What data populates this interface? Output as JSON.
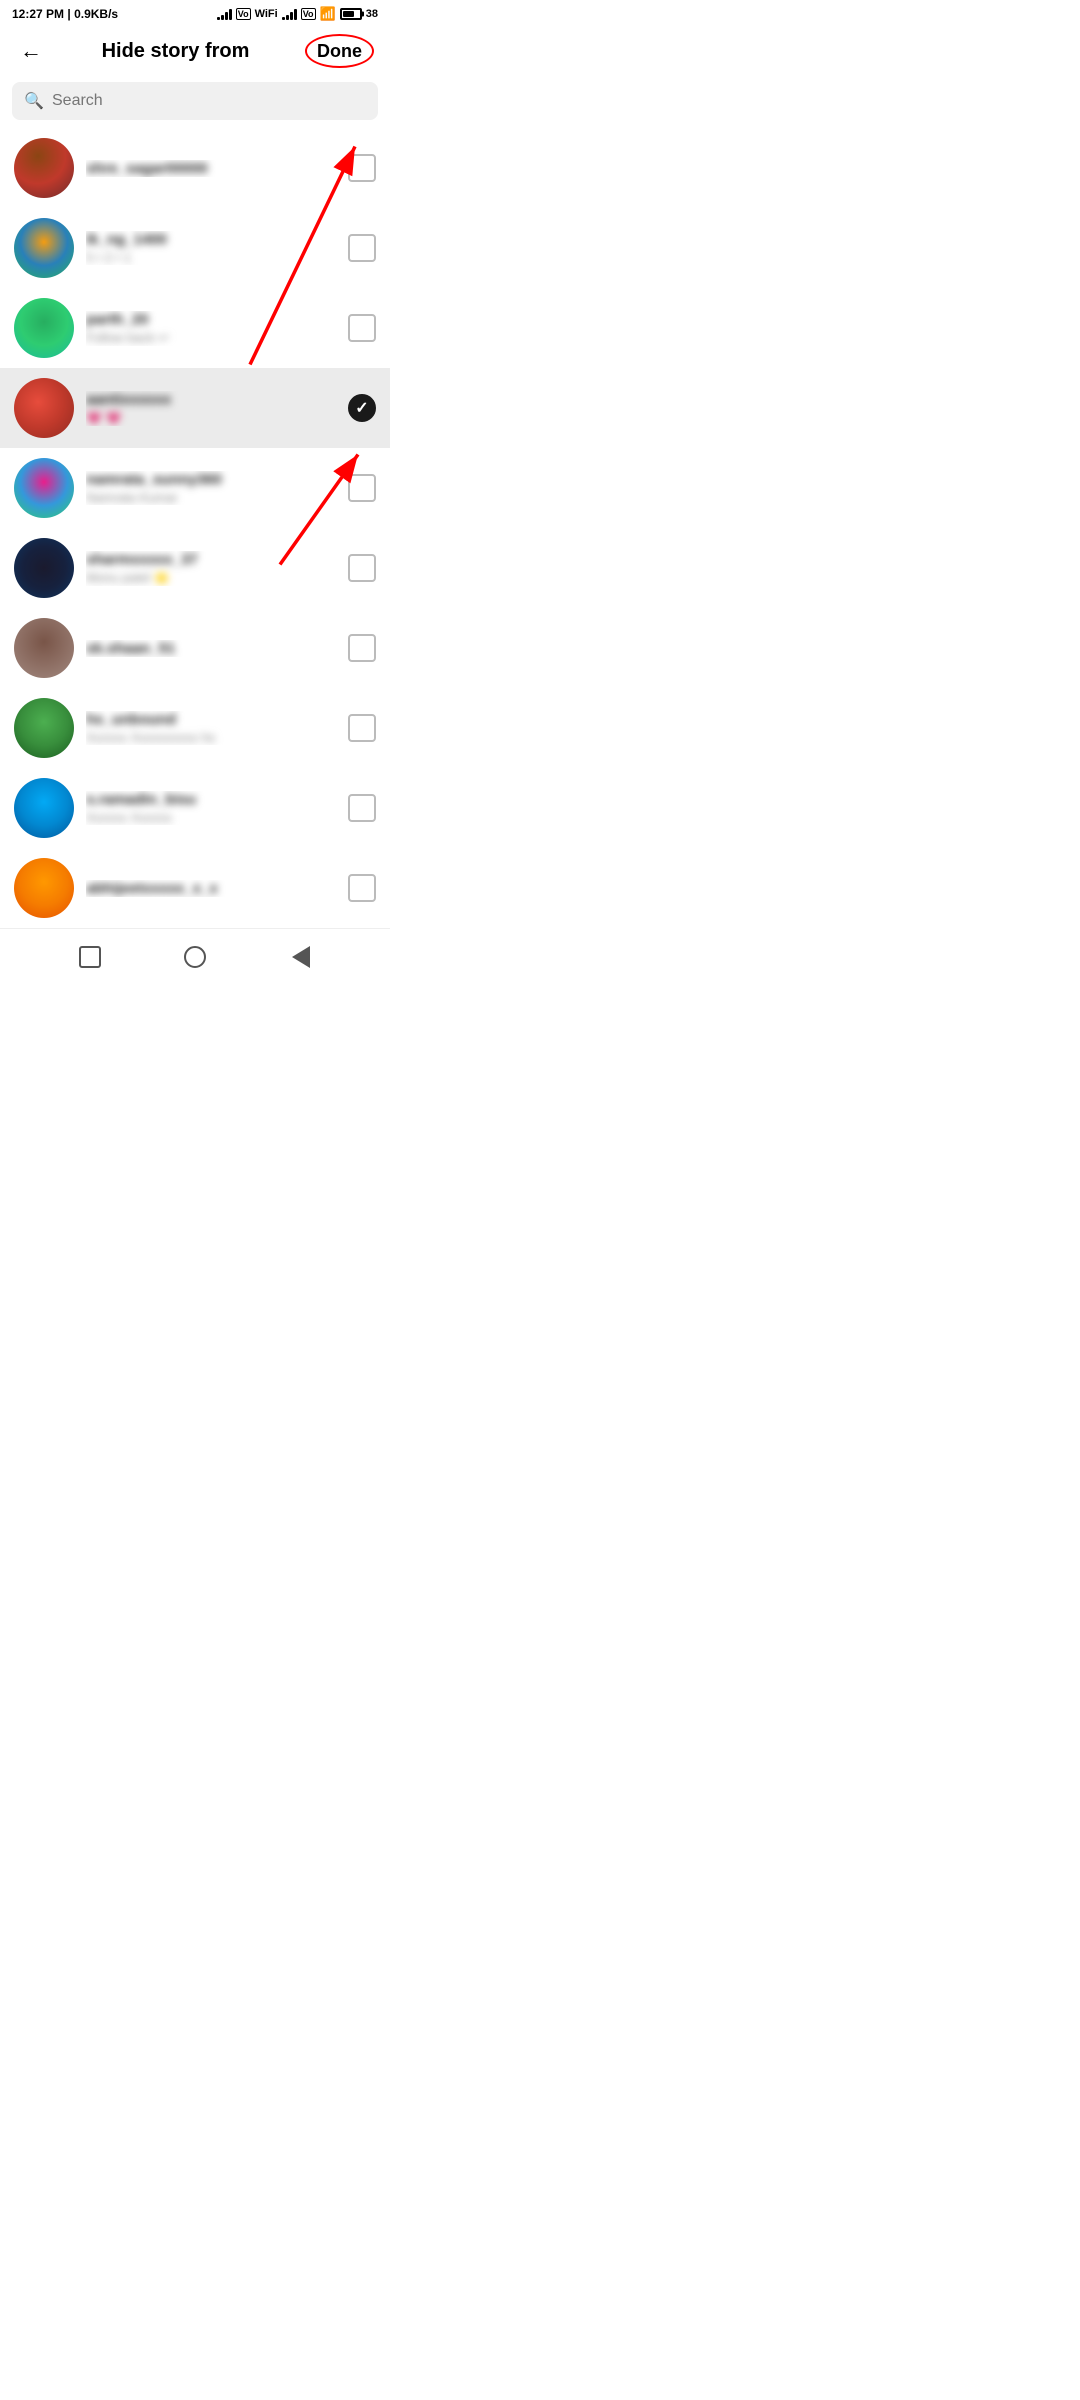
{
  "statusBar": {
    "time": "12:27 PM",
    "speed": "0.9KB/s",
    "battery": "38"
  },
  "header": {
    "backLabel": "←",
    "title": "Hide story from",
    "doneLabel": "Done"
  },
  "search": {
    "placeholder": "Search"
  },
  "contacts": [
    {
      "id": 1,
      "name": "shre_sagar00000",
      "sub": "",
      "checked": false,
      "avatarClass": "avatar-1"
    },
    {
      "id": 2,
      "name": "ik_ng_1400",
      "sub": "5 • 2 • 1",
      "checked": false,
      "avatarClass": "avatar-2"
    },
    {
      "id": 3,
      "name": "parth_20",
      "sub": "Follow back ↩",
      "checked": false,
      "avatarClass": "avatar-3"
    },
    {
      "id": 4,
      "name": "aantixxxxxx",
      "sub": "💗 💗",
      "checked": true,
      "avatarClass": "avatar-4",
      "selected": true
    },
    {
      "id": 5,
      "name": "namrata_sunny360",
      "sub": "Namrata Kumar",
      "checked": false,
      "avatarClass": "avatar-5"
    },
    {
      "id": 6,
      "name": "sharmxxxxx_37",
      "sub": "Monu patel 🌟",
      "checked": false,
      "avatarClass": "avatar-6"
    },
    {
      "id": 7,
      "name": "sk.shaan_51",
      "sub": "",
      "checked": false,
      "avatarClass": "avatar-7"
    },
    {
      "id": 8,
      "name": "hs_unbound",
      "sub": "Xxxxxx Xxxxxxxxxx hs",
      "checked": false,
      "avatarClass": "avatar-8"
    },
    {
      "id": 9,
      "name": "s.ramadin_bisu",
      "sub": "Xxxxxx Xxxxxx",
      "checked": false,
      "avatarClass": "avatar-9"
    },
    {
      "id": 10,
      "name": "abhijeetxxxxx_x_x",
      "sub": "",
      "checked": false,
      "avatarClass": "avatar-10"
    }
  ],
  "navBar": {
    "square": "■",
    "circle": "○",
    "back": "◁"
  }
}
